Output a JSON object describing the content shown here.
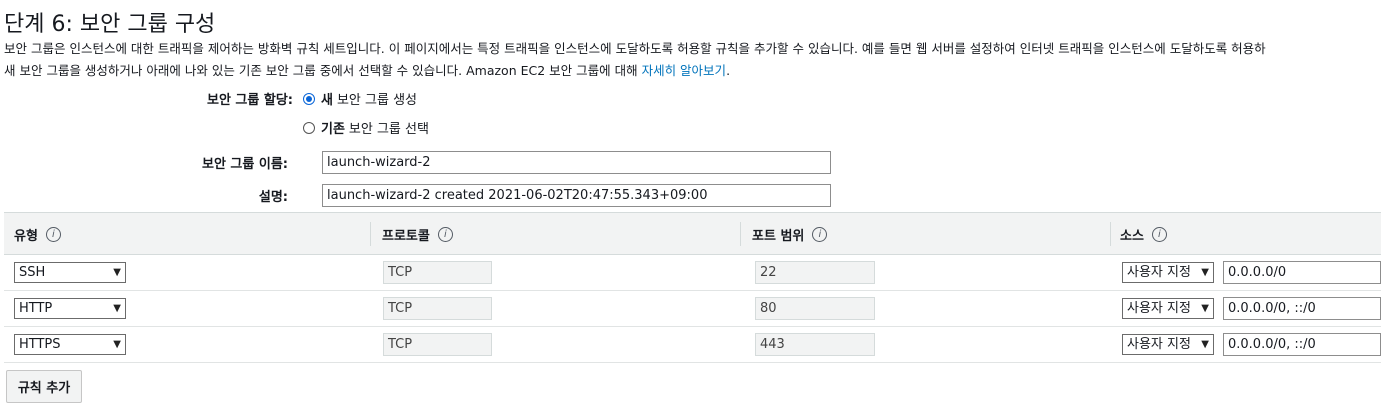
{
  "page": {
    "title": "단계 6: 보안 그룹 구성",
    "description_line1": "보안 그룹은 인스턴스에 대한 트래픽을 제어하는 방화벽 규칙 세트입니다. 이 페이지에서는 특정 트래픽을 인스턴스에 도달하도록 허용할 규칙을 추가할 수 있습니다. 예를 들면 웹 서버를 설정하여 인터넷 트래픽을 인스턴스에 도달하도록 허용하",
    "description_line2": "새 보안 그룹을 생성하거나 아래에 나와 있는 기존 보안 그룹 중에서 선택할 수 있습니다. Amazon EC2 보안 그룹에 대해 ",
    "learn_more_link": "자세히 알아보기",
    "link_suffix": "."
  },
  "assign": {
    "label": "보안 그룹 할당:",
    "option_new_bold": "새",
    "option_new_rest": "보안 그룹 생성",
    "option_existing_bold": "기존",
    "option_existing_rest": "보안 그룹 선택",
    "selected": "new"
  },
  "form": {
    "name_label": "보안 그룹 이름:",
    "name_value": "launch-wizard-2",
    "desc_label": "설명:",
    "desc_value": "launch-wizard-2 created 2021-06-02T20:47:55.343+09:00"
  },
  "table": {
    "columns": [
      "유형",
      "프로토콜",
      "포트 범위",
      "소스"
    ],
    "info_glyph": "i",
    "rows": [
      {
        "type": "SSH",
        "protocol": "TCP",
        "port": "22",
        "source_mode": "사용자 지정",
        "source_value": "0.0.0.0/0"
      },
      {
        "type": "HTTP",
        "protocol": "TCP",
        "port": "80",
        "source_mode": "사용자 지정",
        "source_value": "0.0.0.0/0, ::/0"
      },
      {
        "type": "HTTPS",
        "protocol": "TCP",
        "port": "443",
        "source_mode": "사용자 지정",
        "source_value": "0.0.0.0/0, ::/0"
      }
    ]
  },
  "buttons": {
    "add_rule": "규칙 추가"
  },
  "icons": {
    "chevron": "chevron-down-icon",
    "info": "info-icon"
  },
  "colors": {
    "link": "#0073bb",
    "radio_selected": "#0a66d8",
    "header_bg": "#f2f3f3"
  }
}
